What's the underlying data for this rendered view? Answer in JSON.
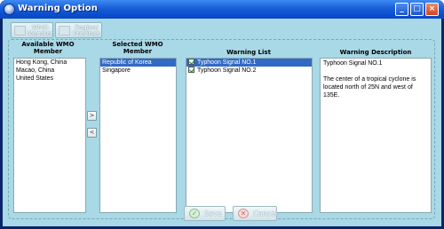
{
  "window": {
    "title": "Warning Option",
    "controls": {
      "minimize": "_",
      "maximize": "□",
      "close": "×"
    }
  },
  "toolbar": {
    "wmo_member_label": "WMO Member",
    "region_province_label": "Region/ Province"
  },
  "columns": {
    "available_header": "Available WMO Member",
    "selected_header": "Selected WMO Member",
    "warning_list_header": "Warning List",
    "warning_desc_header": "Warning Description"
  },
  "available_members": [
    "Hong Kong, China",
    "Macao, China",
    "United States"
  ],
  "selected_members": [
    "Republic of Korea",
    "Singapore"
  ],
  "selected_member_highlight_index": 0,
  "warnings": [
    {
      "label": "Typhoon Signal NO.1",
      "checked": true,
      "highlighted": true
    },
    {
      "label": "Typhoon Signal NO.2",
      "checked": true,
      "highlighted": false
    }
  ],
  "description": {
    "title": "Typhoon Signal NO.1",
    "body": "The center of a tropical cyclone is located north of 25N and west of 135E."
  },
  "move_buttons": {
    "add": ">",
    "remove": "<"
  },
  "actions": {
    "save_label": "Save",
    "cancel_label": "Cancel"
  },
  "icons": {
    "window": "globe-icon",
    "wmo_member": "member-icon",
    "region": "region-icon",
    "save": "checkmark-icon",
    "cancel": "cancel-icon"
  }
}
